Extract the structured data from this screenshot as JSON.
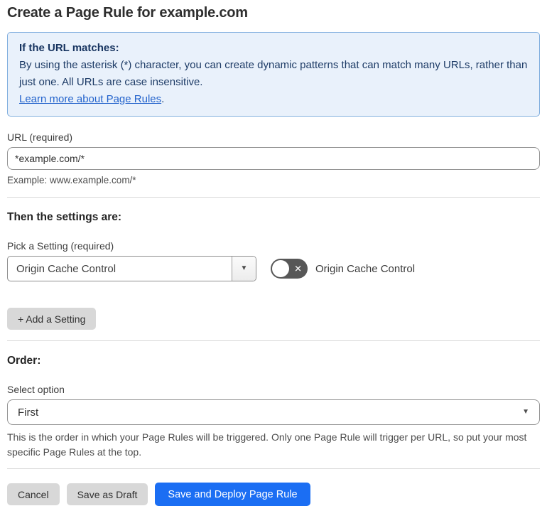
{
  "page": {
    "title": "Create a Page Rule for example.com"
  },
  "info_box": {
    "heading": "If the URL matches:",
    "body": "By using the asterisk (*) character, you can create dynamic patterns that can match many URLs, rather than just one. All URLs are case insensitive.",
    "link_text": "Learn more about Page Rules",
    "link_suffix": "."
  },
  "url_field": {
    "label": "URL (required)",
    "value": "*example.com/*",
    "hint": "Example: www.example.com/*"
  },
  "settings": {
    "heading": "Then the settings are:",
    "picker_label": "Pick a Setting (required)",
    "picker_value": "Origin Cache Control",
    "toggle_label": "Origin Cache Control",
    "toggle_state": "off",
    "add_button_label": "+ Add a Setting"
  },
  "order": {
    "heading": "Order:",
    "select_label": "Select option",
    "select_value": "First",
    "help_text": "This is the order in which your Page Rules will be triggered. Only one Page Rule will trigger per URL, so put your most specific Page Rules at the top."
  },
  "footer": {
    "cancel_label": "Cancel",
    "save_draft_label": "Save as Draft",
    "save_deploy_label": "Save and Deploy Page Rule"
  },
  "icons": {
    "dropdown_arrow": "▼",
    "toggle_x": "✕"
  },
  "colors": {
    "info_box_bg": "#e9f1fb",
    "info_box_border": "#80aede",
    "info_text": "#1d3b66",
    "link": "#2363cc",
    "primary_button": "#1b6ef3",
    "secondary_button": "#d8d8d8",
    "toggle_track": "#575757"
  }
}
